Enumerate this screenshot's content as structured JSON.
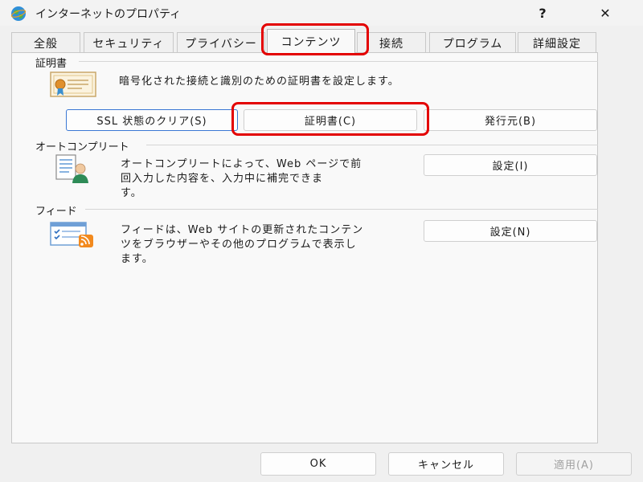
{
  "window": {
    "title": "インターネットのプロパティ",
    "help_label": "?",
    "close_label": "✕"
  },
  "tabs": [
    {
      "label": "全般"
    },
    {
      "label": "セキュリティ"
    },
    {
      "label": "プライバシー"
    },
    {
      "label": "コンテンツ",
      "selected": true
    },
    {
      "label": "接続"
    },
    {
      "label": "プログラム"
    },
    {
      "label": "詳細設定"
    }
  ],
  "certificates": {
    "heading": "証明書",
    "description": "暗号化された接続と識別のための証明書を設定します。",
    "ssl_clear_label": "SSL 状態のクリア(S)",
    "certificates_label": "証明書(C)",
    "publishers_label": "発行元(B)"
  },
  "autocomplete": {
    "heading": "オートコンプリート",
    "description_line1": "オートコンプリートによって、Web ページで前",
    "description_line2": "回入力した内容を、入力中に補完できま",
    "description_line3": "す。",
    "settings_label": "設定(I)"
  },
  "feeds": {
    "heading": "フィード",
    "description_line1": "フィードは、Web サイトの更新されたコンテン",
    "description_line2": "ツをブラウザーやその他のプログラムで表示し",
    "description_line3": "ます。",
    "settings_label": "設定(N)"
  },
  "footer": {
    "ok_label": "OK",
    "cancel_label": "キャンセル",
    "apply_label": "適用(A)"
  },
  "colors": {
    "highlight": "#e30000",
    "focus_border": "#3b78d4"
  }
}
